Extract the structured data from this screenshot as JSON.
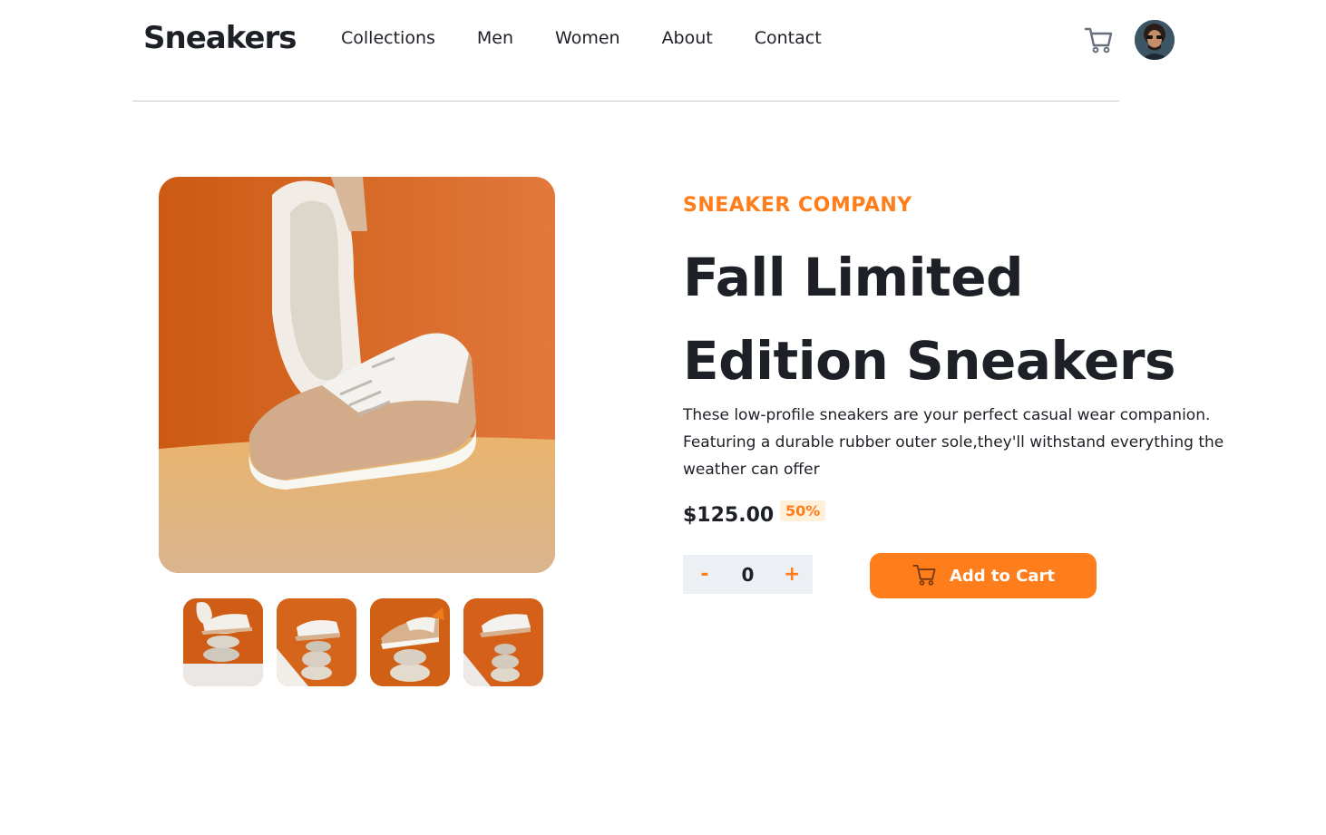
{
  "header": {
    "logo": "Sneakers",
    "nav": [
      "Collections",
      "Men",
      "Women",
      "About",
      "Contact"
    ],
    "icons": {
      "cart": "cart-icon",
      "avatar": "user-avatar"
    }
  },
  "gallery": {
    "main_image": "sneaker-main-image",
    "thumbnails": [
      "thumbnail-1",
      "thumbnail-2",
      "thumbnail-3",
      "thumbnail-4"
    ]
  },
  "product": {
    "company": "SNEAKER COMPANY",
    "title": "Fall Limited Edition Sneakers",
    "description": "These low-profile sneakers are your perfect casual wear companion. Featuring a durable rubber outer sole,they'll withstand everything the weather can offer",
    "price": "$125.00",
    "discount": "50%"
  },
  "quantity": {
    "minus": "-",
    "value": "0",
    "plus": "+"
  },
  "add_to_cart": {
    "label": "Add to Cart",
    "icon": "cart-icon"
  },
  "colors": {
    "accent": "#ff7e1b",
    "text": "#1d2026",
    "accent_light": "#fff0d9",
    "qty_bg": "#eceff3"
  }
}
